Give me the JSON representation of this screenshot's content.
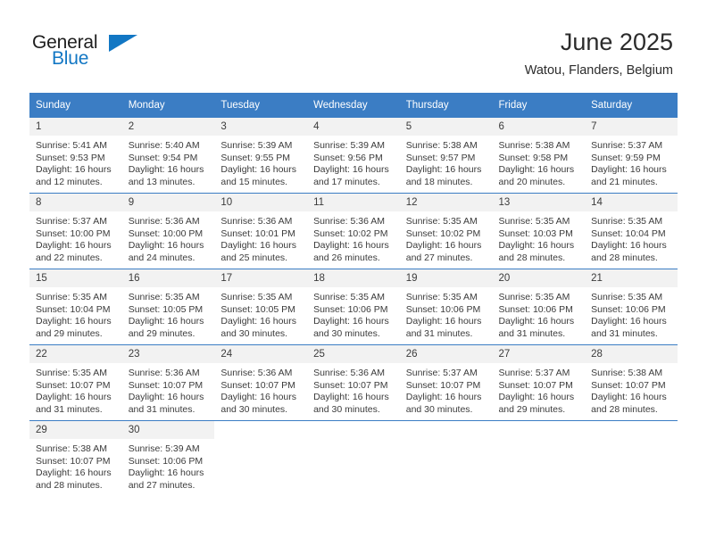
{
  "brand": {
    "name_top": "General",
    "name_bottom": "Blue",
    "mark": "triangle-logo",
    "accent_color": "#1277c4"
  },
  "header": {
    "title": "June 2025",
    "subtitle": "Watou, Flanders, Belgium"
  },
  "colors": {
    "header_blue": "#3b7dc4",
    "daynum_bg": "#f2f2f2",
    "text": "#3b3b3b"
  },
  "weekday_headers": [
    "Sunday",
    "Monday",
    "Tuesday",
    "Wednesday",
    "Thursday",
    "Friday",
    "Saturday"
  ],
  "weeks": [
    [
      {
        "day": "1",
        "sunrise": "Sunrise: 5:41 AM",
        "sunset": "Sunset: 9:53 PM",
        "daylight1": "Daylight: 16 hours",
        "daylight2": "and 12 minutes."
      },
      {
        "day": "2",
        "sunrise": "Sunrise: 5:40 AM",
        "sunset": "Sunset: 9:54 PM",
        "daylight1": "Daylight: 16 hours",
        "daylight2": "and 13 minutes."
      },
      {
        "day": "3",
        "sunrise": "Sunrise: 5:39 AM",
        "sunset": "Sunset: 9:55 PM",
        "daylight1": "Daylight: 16 hours",
        "daylight2": "and 15 minutes."
      },
      {
        "day": "4",
        "sunrise": "Sunrise: 5:39 AM",
        "sunset": "Sunset: 9:56 PM",
        "daylight1": "Daylight: 16 hours",
        "daylight2": "and 17 minutes."
      },
      {
        "day": "5",
        "sunrise": "Sunrise: 5:38 AM",
        "sunset": "Sunset: 9:57 PM",
        "daylight1": "Daylight: 16 hours",
        "daylight2": "and 18 minutes."
      },
      {
        "day": "6",
        "sunrise": "Sunrise: 5:38 AM",
        "sunset": "Sunset: 9:58 PM",
        "daylight1": "Daylight: 16 hours",
        "daylight2": "and 20 minutes."
      },
      {
        "day": "7",
        "sunrise": "Sunrise: 5:37 AM",
        "sunset": "Sunset: 9:59 PM",
        "daylight1": "Daylight: 16 hours",
        "daylight2": "and 21 minutes."
      }
    ],
    [
      {
        "day": "8",
        "sunrise": "Sunrise: 5:37 AM",
        "sunset": "Sunset: 10:00 PM",
        "daylight1": "Daylight: 16 hours",
        "daylight2": "and 22 minutes."
      },
      {
        "day": "9",
        "sunrise": "Sunrise: 5:36 AM",
        "sunset": "Sunset: 10:00 PM",
        "daylight1": "Daylight: 16 hours",
        "daylight2": "and 24 minutes."
      },
      {
        "day": "10",
        "sunrise": "Sunrise: 5:36 AM",
        "sunset": "Sunset: 10:01 PM",
        "daylight1": "Daylight: 16 hours",
        "daylight2": "and 25 minutes."
      },
      {
        "day": "11",
        "sunrise": "Sunrise: 5:36 AM",
        "sunset": "Sunset: 10:02 PM",
        "daylight1": "Daylight: 16 hours",
        "daylight2": "and 26 minutes."
      },
      {
        "day": "12",
        "sunrise": "Sunrise: 5:35 AM",
        "sunset": "Sunset: 10:02 PM",
        "daylight1": "Daylight: 16 hours",
        "daylight2": "and 27 minutes."
      },
      {
        "day": "13",
        "sunrise": "Sunrise: 5:35 AM",
        "sunset": "Sunset: 10:03 PM",
        "daylight1": "Daylight: 16 hours",
        "daylight2": "and 28 minutes."
      },
      {
        "day": "14",
        "sunrise": "Sunrise: 5:35 AM",
        "sunset": "Sunset: 10:04 PM",
        "daylight1": "Daylight: 16 hours",
        "daylight2": "and 28 minutes."
      }
    ],
    [
      {
        "day": "15",
        "sunrise": "Sunrise: 5:35 AM",
        "sunset": "Sunset: 10:04 PM",
        "daylight1": "Daylight: 16 hours",
        "daylight2": "and 29 minutes."
      },
      {
        "day": "16",
        "sunrise": "Sunrise: 5:35 AM",
        "sunset": "Sunset: 10:05 PM",
        "daylight1": "Daylight: 16 hours",
        "daylight2": "and 29 minutes."
      },
      {
        "day": "17",
        "sunrise": "Sunrise: 5:35 AM",
        "sunset": "Sunset: 10:05 PM",
        "daylight1": "Daylight: 16 hours",
        "daylight2": "and 30 minutes."
      },
      {
        "day": "18",
        "sunrise": "Sunrise: 5:35 AM",
        "sunset": "Sunset: 10:06 PM",
        "daylight1": "Daylight: 16 hours",
        "daylight2": "and 30 minutes."
      },
      {
        "day": "19",
        "sunrise": "Sunrise: 5:35 AM",
        "sunset": "Sunset: 10:06 PM",
        "daylight1": "Daylight: 16 hours",
        "daylight2": "and 31 minutes."
      },
      {
        "day": "20",
        "sunrise": "Sunrise: 5:35 AM",
        "sunset": "Sunset: 10:06 PM",
        "daylight1": "Daylight: 16 hours",
        "daylight2": "and 31 minutes."
      },
      {
        "day": "21",
        "sunrise": "Sunrise: 5:35 AM",
        "sunset": "Sunset: 10:06 PM",
        "daylight1": "Daylight: 16 hours",
        "daylight2": "and 31 minutes."
      }
    ],
    [
      {
        "day": "22",
        "sunrise": "Sunrise: 5:35 AM",
        "sunset": "Sunset: 10:07 PM",
        "daylight1": "Daylight: 16 hours",
        "daylight2": "and 31 minutes."
      },
      {
        "day": "23",
        "sunrise": "Sunrise: 5:36 AM",
        "sunset": "Sunset: 10:07 PM",
        "daylight1": "Daylight: 16 hours",
        "daylight2": "and 31 minutes."
      },
      {
        "day": "24",
        "sunrise": "Sunrise: 5:36 AM",
        "sunset": "Sunset: 10:07 PM",
        "daylight1": "Daylight: 16 hours",
        "daylight2": "and 30 minutes."
      },
      {
        "day": "25",
        "sunrise": "Sunrise: 5:36 AM",
        "sunset": "Sunset: 10:07 PM",
        "daylight1": "Daylight: 16 hours",
        "daylight2": "and 30 minutes."
      },
      {
        "day": "26",
        "sunrise": "Sunrise: 5:37 AM",
        "sunset": "Sunset: 10:07 PM",
        "daylight1": "Daylight: 16 hours",
        "daylight2": "and 30 minutes."
      },
      {
        "day": "27",
        "sunrise": "Sunrise: 5:37 AM",
        "sunset": "Sunset: 10:07 PM",
        "daylight1": "Daylight: 16 hours",
        "daylight2": "and 29 minutes."
      },
      {
        "day": "28",
        "sunrise": "Sunrise: 5:38 AM",
        "sunset": "Sunset: 10:07 PM",
        "daylight1": "Daylight: 16 hours",
        "daylight2": "and 28 minutes."
      }
    ],
    [
      {
        "day": "29",
        "sunrise": "Sunrise: 5:38 AM",
        "sunset": "Sunset: 10:07 PM",
        "daylight1": "Daylight: 16 hours",
        "daylight2": "and 28 minutes."
      },
      {
        "day": "30",
        "sunrise": "Sunrise: 5:39 AM",
        "sunset": "Sunset: 10:06 PM",
        "daylight1": "Daylight: 16 hours",
        "daylight2": "and 27 minutes."
      },
      {
        "day": "",
        "sunrise": "",
        "sunset": "",
        "daylight1": "",
        "daylight2": ""
      },
      {
        "day": "",
        "sunrise": "",
        "sunset": "",
        "daylight1": "",
        "daylight2": ""
      },
      {
        "day": "",
        "sunrise": "",
        "sunset": "",
        "daylight1": "",
        "daylight2": ""
      },
      {
        "day": "",
        "sunrise": "",
        "sunset": "",
        "daylight1": "",
        "daylight2": ""
      },
      {
        "day": "",
        "sunrise": "",
        "sunset": "",
        "daylight1": "",
        "daylight2": ""
      }
    ]
  ]
}
